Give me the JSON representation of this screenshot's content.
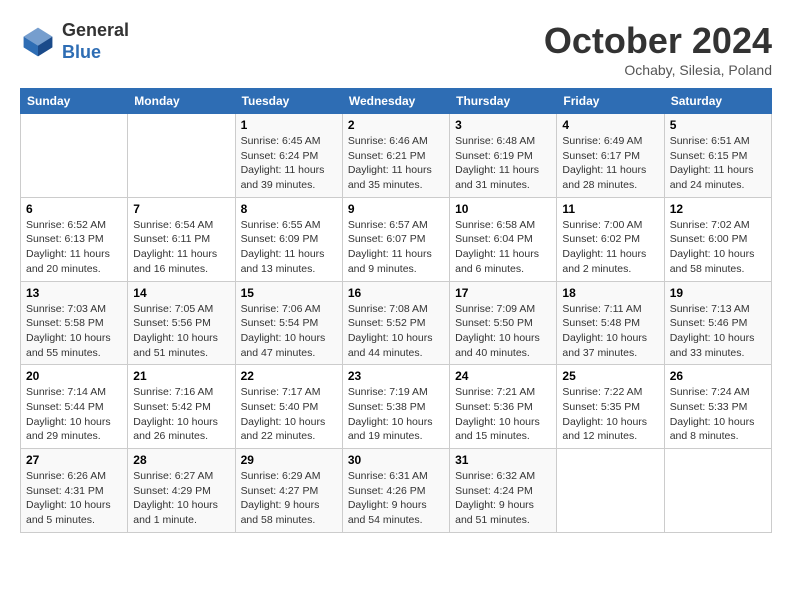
{
  "header": {
    "logo_general": "General",
    "logo_blue": "Blue",
    "month_title": "October 2024",
    "location": "Ochaby, Silesia, Poland"
  },
  "days_of_week": [
    "Sunday",
    "Monday",
    "Tuesday",
    "Wednesday",
    "Thursday",
    "Friday",
    "Saturday"
  ],
  "weeks": [
    [
      {
        "day": "",
        "info": ""
      },
      {
        "day": "",
        "info": ""
      },
      {
        "day": "1",
        "info": "Sunrise: 6:45 AM\nSunset: 6:24 PM\nDaylight: 11 hours and 39 minutes."
      },
      {
        "day": "2",
        "info": "Sunrise: 6:46 AM\nSunset: 6:21 PM\nDaylight: 11 hours and 35 minutes."
      },
      {
        "day": "3",
        "info": "Sunrise: 6:48 AM\nSunset: 6:19 PM\nDaylight: 11 hours and 31 minutes."
      },
      {
        "day": "4",
        "info": "Sunrise: 6:49 AM\nSunset: 6:17 PM\nDaylight: 11 hours and 28 minutes."
      },
      {
        "day": "5",
        "info": "Sunrise: 6:51 AM\nSunset: 6:15 PM\nDaylight: 11 hours and 24 minutes."
      }
    ],
    [
      {
        "day": "6",
        "info": "Sunrise: 6:52 AM\nSunset: 6:13 PM\nDaylight: 11 hours and 20 minutes."
      },
      {
        "day": "7",
        "info": "Sunrise: 6:54 AM\nSunset: 6:11 PM\nDaylight: 11 hours and 16 minutes."
      },
      {
        "day": "8",
        "info": "Sunrise: 6:55 AM\nSunset: 6:09 PM\nDaylight: 11 hours and 13 minutes."
      },
      {
        "day": "9",
        "info": "Sunrise: 6:57 AM\nSunset: 6:07 PM\nDaylight: 11 hours and 9 minutes."
      },
      {
        "day": "10",
        "info": "Sunrise: 6:58 AM\nSunset: 6:04 PM\nDaylight: 11 hours and 6 minutes."
      },
      {
        "day": "11",
        "info": "Sunrise: 7:00 AM\nSunset: 6:02 PM\nDaylight: 11 hours and 2 minutes."
      },
      {
        "day": "12",
        "info": "Sunrise: 7:02 AM\nSunset: 6:00 PM\nDaylight: 10 hours and 58 minutes."
      }
    ],
    [
      {
        "day": "13",
        "info": "Sunrise: 7:03 AM\nSunset: 5:58 PM\nDaylight: 10 hours and 55 minutes."
      },
      {
        "day": "14",
        "info": "Sunrise: 7:05 AM\nSunset: 5:56 PM\nDaylight: 10 hours and 51 minutes."
      },
      {
        "day": "15",
        "info": "Sunrise: 7:06 AM\nSunset: 5:54 PM\nDaylight: 10 hours and 47 minutes."
      },
      {
        "day": "16",
        "info": "Sunrise: 7:08 AM\nSunset: 5:52 PM\nDaylight: 10 hours and 44 minutes."
      },
      {
        "day": "17",
        "info": "Sunrise: 7:09 AM\nSunset: 5:50 PM\nDaylight: 10 hours and 40 minutes."
      },
      {
        "day": "18",
        "info": "Sunrise: 7:11 AM\nSunset: 5:48 PM\nDaylight: 10 hours and 37 minutes."
      },
      {
        "day": "19",
        "info": "Sunrise: 7:13 AM\nSunset: 5:46 PM\nDaylight: 10 hours and 33 minutes."
      }
    ],
    [
      {
        "day": "20",
        "info": "Sunrise: 7:14 AM\nSunset: 5:44 PM\nDaylight: 10 hours and 29 minutes."
      },
      {
        "day": "21",
        "info": "Sunrise: 7:16 AM\nSunset: 5:42 PM\nDaylight: 10 hours and 26 minutes."
      },
      {
        "day": "22",
        "info": "Sunrise: 7:17 AM\nSunset: 5:40 PM\nDaylight: 10 hours and 22 minutes."
      },
      {
        "day": "23",
        "info": "Sunrise: 7:19 AM\nSunset: 5:38 PM\nDaylight: 10 hours and 19 minutes."
      },
      {
        "day": "24",
        "info": "Sunrise: 7:21 AM\nSunset: 5:36 PM\nDaylight: 10 hours and 15 minutes."
      },
      {
        "day": "25",
        "info": "Sunrise: 7:22 AM\nSunset: 5:35 PM\nDaylight: 10 hours and 12 minutes."
      },
      {
        "day": "26",
        "info": "Sunrise: 7:24 AM\nSunset: 5:33 PM\nDaylight: 10 hours and 8 minutes."
      }
    ],
    [
      {
        "day": "27",
        "info": "Sunrise: 6:26 AM\nSunset: 4:31 PM\nDaylight: 10 hours and 5 minutes."
      },
      {
        "day": "28",
        "info": "Sunrise: 6:27 AM\nSunset: 4:29 PM\nDaylight: 10 hours and 1 minute."
      },
      {
        "day": "29",
        "info": "Sunrise: 6:29 AM\nSunset: 4:27 PM\nDaylight: 9 hours and 58 minutes."
      },
      {
        "day": "30",
        "info": "Sunrise: 6:31 AM\nSunset: 4:26 PM\nDaylight: 9 hours and 54 minutes."
      },
      {
        "day": "31",
        "info": "Sunrise: 6:32 AM\nSunset: 4:24 PM\nDaylight: 9 hours and 51 minutes."
      },
      {
        "day": "",
        "info": ""
      },
      {
        "day": "",
        "info": ""
      }
    ]
  ]
}
